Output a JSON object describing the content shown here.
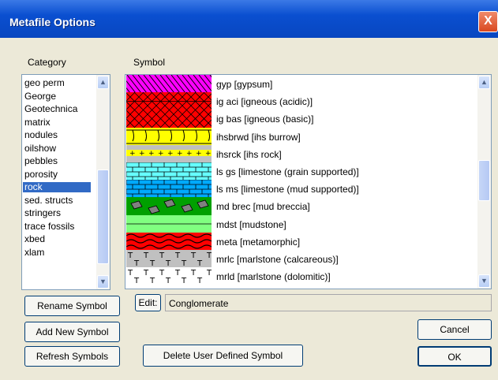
{
  "window": {
    "title": "Metafile Options",
    "close_glyph": "X"
  },
  "labels": {
    "category": "Category",
    "symbol": "Symbol",
    "edit": "Edit:"
  },
  "categories": [
    {
      "label": "geo perm",
      "selected": false
    },
    {
      "label": "George",
      "selected": false
    },
    {
      "label": "Geotechnica",
      "selected": false
    },
    {
      "label": "matrix",
      "selected": false
    },
    {
      "label": "nodules",
      "selected": false
    },
    {
      "label": "oilshow",
      "selected": false
    },
    {
      "label": "pebbles",
      "selected": false
    },
    {
      "label": "porosity",
      "selected": false
    },
    {
      "label": "rock",
      "selected": true
    },
    {
      "label": "sed. structs",
      "selected": false
    },
    {
      "label": "stringers",
      "selected": false
    },
    {
      "label": "trace fossils",
      "selected": false
    },
    {
      "label": "xbed",
      "selected": false
    },
    {
      "label": "xlam",
      "selected": false
    }
  ],
  "symbols": [
    {
      "label": "gyp [gypsum]",
      "pattern": "gypsum",
      "color": "#ff00ff"
    },
    {
      "label": "ig aci [igneous (acidic)]",
      "pattern": "acidic",
      "color": "#ff0000"
    },
    {
      "label": "ig bas [igneous (basic)]",
      "pattern": "basic",
      "color": "#ff0000"
    },
    {
      "label": "ihsbrwd [ihs burrow]",
      "pattern": "burrow",
      "color": "#ffff00"
    },
    {
      "label": "ihsrck [ihs rock]",
      "pattern": "ihsrock",
      "color": "#c0c0c0"
    },
    {
      "label": "ls gs [limestone (grain supported)]",
      "pattern": "limestone-gs",
      "color": "#66ffff"
    },
    {
      "label": "ls ms [limestone (mud supported)]",
      "pattern": "limestone-ms",
      "color": "#00aaff"
    },
    {
      "label": "md brec [mud breccia]",
      "pattern": "breccia",
      "color": "#00a000"
    },
    {
      "label": "mdst [mudstone]",
      "pattern": "mudstone",
      "color": "#80ff80"
    },
    {
      "label": "meta [metamorphic]",
      "pattern": "metamorphic",
      "color": "#ff0000"
    },
    {
      "label": "mrlc [marlstone (calcareous)]",
      "pattern": "marl",
      "color": "#c0c0c0"
    },
    {
      "label": "mrld [marlstone (dolomitic)]",
      "pattern": "marl2",
      "color": "#ffffff"
    }
  ],
  "edit_value": "Conglomerate",
  "buttons": {
    "rename": "Rename Symbol",
    "add": "Add New Symbol",
    "refresh": "Refresh Symbols",
    "delete": "Delete User Defined Symbol",
    "cancel": "Cancel",
    "ok": "OK"
  }
}
